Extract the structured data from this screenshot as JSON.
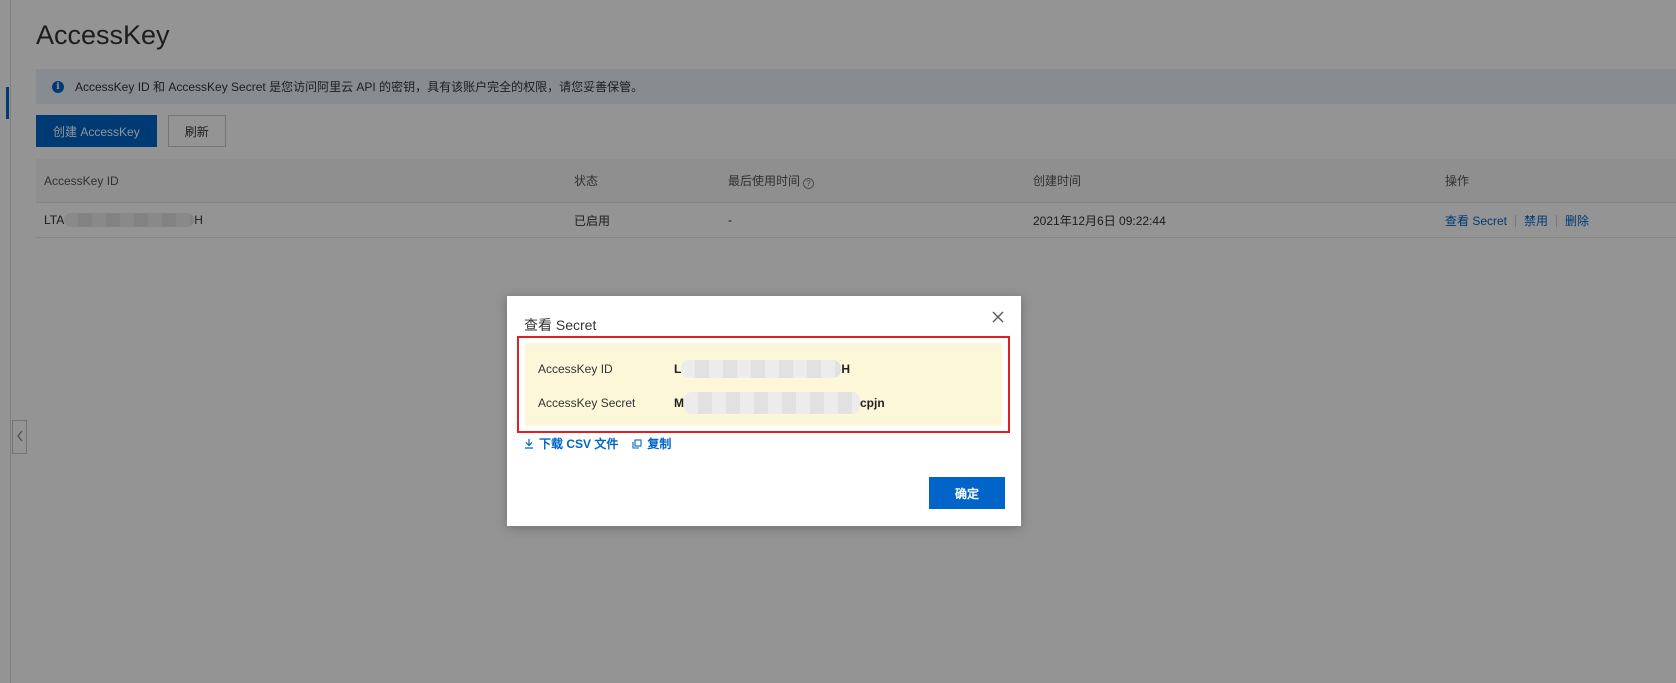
{
  "page": {
    "title": "AccessKey",
    "notice": "AccessKey ID 和 AccessKey Secret 是您访问阿里云 API 的密钥，具有该账户完全的权限，请您妥善保管。"
  },
  "toolbar": {
    "create_label": "创建 AccessKey",
    "refresh_label": "刷新"
  },
  "table": {
    "columns": [
      "AccessKey ID",
      "状态",
      "最后使用时间",
      "创建时间",
      "操作"
    ],
    "rows": [
      {
        "id_prefix": "LTA",
        "id_suffix": "H",
        "status": "已启用",
        "last_used": "-",
        "created": "2021年12月6日 09:22:44",
        "actions": [
          "查看 Secret",
          "禁用",
          "删除"
        ]
      }
    ]
  },
  "dialog": {
    "title": "查看 Secret",
    "id_label": "AccessKey ID",
    "id_prefix": "L",
    "id_suffix": "H",
    "secret_label": "AccessKey Secret",
    "secret_prefix": "M",
    "secret_suffix": "cpjn",
    "download_label": "下载 CSV 文件",
    "copy_label": "复制",
    "ok_label": "确定"
  },
  "icons": {
    "info": "info-icon",
    "help": "question-circle-icon",
    "close": "close-icon",
    "download": "download-icon",
    "copy": "copy-icon",
    "collapse": "chevron-left-icon"
  },
  "colors": {
    "primary": "#0064c8",
    "highlight_border": "#e02020",
    "secret_background": "#fdf7d9",
    "notice_background": "#ebf1fa"
  }
}
